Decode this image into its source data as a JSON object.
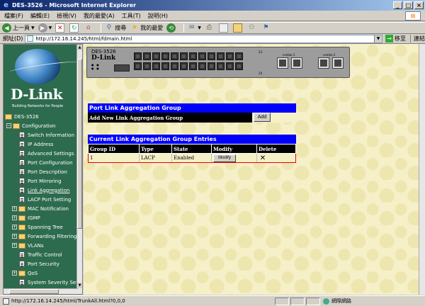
{
  "window": {
    "title": "DES-3526 - Microsoft Internet Explorer"
  },
  "menu": [
    "檔案(F)",
    "編輯(E)",
    "檢視(V)",
    "我的最愛(A)",
    "工具(T)",
    "說明(H)"
  ],
  "toolbar": {
    "back": "上一頁",
    "search": "搜尋",
    "favorites": "我的最愛"
  },
  "address": {
    "label": "網址(D)",
    "url": "http://172.16.14.245/html/fdmain.html",
    "go": "移至",
    "links": "連結"
  },
  "sidebar": {
    "brand": "D-Link",
    "tagline": "Building Networks for People",
    "root": "DES-3526",
    "configuration": "Configuration",
    "items": [
      {
        "label": "Switch Information",
        "type": "page"
      },
      {
        "label": "IP Address",
        "type": "page"
      },
      {
        "label": "Advanced Settings",
        "type": "page"
      },
      {
        "label": "Port Configuration",
        "type": "page"
      },
      {
        "label": "Port Description",
        "type": "page"
      },
      {
        "label": "Port Mirroring",
        "type": "page"
      },
      {
        "label": "Link Aggregation",
        "type": "page",
        "active": true
      },
      {
        "label": "LACP Port Setting",
        "type": "page"
      },
      {
        "label": "MAC Notification",
        "type": "folder"
      },
      {
        "label": "IGMP",
        "type": "folder"
      },
      {
        "label": "Spanning Tree",
        "type": "folder"
      },
      {
        "label": "Forwarding Filtering",
        "type": "folder"
      },
      {
        "label": "VLANs",
        "type": "folder"
      },
      {
        "label": "Traffic Control",
        "type": "page"
      },
      {
        "label": "Port Security",
        "type": "page"
      },
      {
        "label": "QoS",
        "type": "folder"
      },
      {
        "label": "System Severity Setti",
        "type": "page"
      }
    ]
  },
  "switch": {
    "model": "DES-3526",
    "brand": "D-Link",
    "port_label_left": "23",
    "port_label_left2": "24",
    "combo1": "combo 1",
    "combo2": "combo 2"
  },
  "port_link_group": {
    "header": "Port Link Aggregation Group",
    "add_label": "Add New Link Aggregation Group",
    "add_button": "Add"
  },
  "entries": {
    "header": "Current Link Aggregation Group Entries",
    "columns": [
      "Group ID",
      "Type",
      "State",
      "Modify",
      "Delete"
    ],
    "rows": [
      {
        "group_id": "1",
        "type": "LACP",
        "state": "Enabled",
        "modify": "Modify"
      }
    ]
  },
  "status": {
    "url": "http://172.16.14.245/html/TrunkAll.html?0,0,0",
    "zone": "網際網路"
  }
}
